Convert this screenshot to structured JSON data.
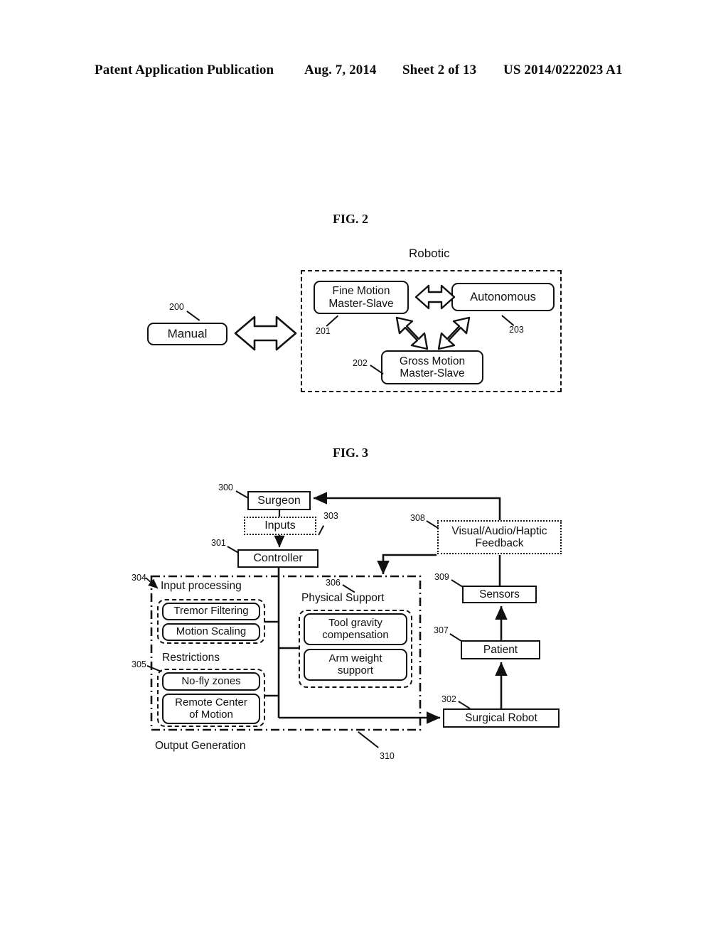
{
  "header": {
    "publication": "Patent Application Publication",
    "date": "Aug. 7, 2014",
    "sheet": "Sheet 2 of 13",
    "docnum": "US 2014/0222023 A1"
  },
  "fig2": {
    "title": "FIG. 2",
    "group_label": "Robotic",
    "nodes": {
      "manual": "Manual",
      "fine_motion": "Fine Motion\nMaster-Slave",
      "fine_motion_l1": "Fine Motion",
      "fine_motion_l2": "Master-Slave",
      "autonomous": "Autonomous",
      "gross_motion_l1": "Gross Motion",
      "gross_motion_l2": "Master-Slave"
    },
    "refs": {
      "manual": "200",
      "fine_motion": "201",
      "gross_motion": "202",
      "autonomous": "203"
    }
  },
  "fig3": {
    "title": "FIG. 3",
    "nodes": {
      "surgeon": "Surgeon",
      "inputs": "Inputs",
      "controller": "Controller",
      "feedback_l1": "Visual/Audio/Haptic",
      "feedback_l2": "Feedback",
      "sensors": "Sensors",
      "patient": "Patient",
      "surgical_robot": "Surgical Robot",
      "tremor_filtering": "Tremor Filtering",
      "motion_scaling": "Motion Scaling",
      "nofly_zones": "No-fly zones",
      "remote_center_l1": "Remote Center",
      "remote_center_l2": "of Motion",
      "tool_gravity_l1": "Tool gravity",
      "tool_gravity_l2": "compensation",
      "arm_weight_l1": "Arm weight",
      "arm_weight_l2": "support"
    },
    "group_labels": {
      "input_processing": "Input processing",
      "restrictions": "Restrictions",
      "physical_support": "Physical Support",
      "output_generation": "Output Generation"
    },
    "refs": {
      "surgeon": "300",
      "controller": "301",
      "surgical_robot": "302",
      "inputs": "303",
      "input_processing": "304",
      "restrictions": "305",
      "physical_support": "306",
      "patient": "307",
      "feedback": "308",
      "sensors": "309",
      "output_generation": "310"
    }
  },
  "colors": {
    "ink": "#111111",
    "paper": "#ffffff"
  }
}
